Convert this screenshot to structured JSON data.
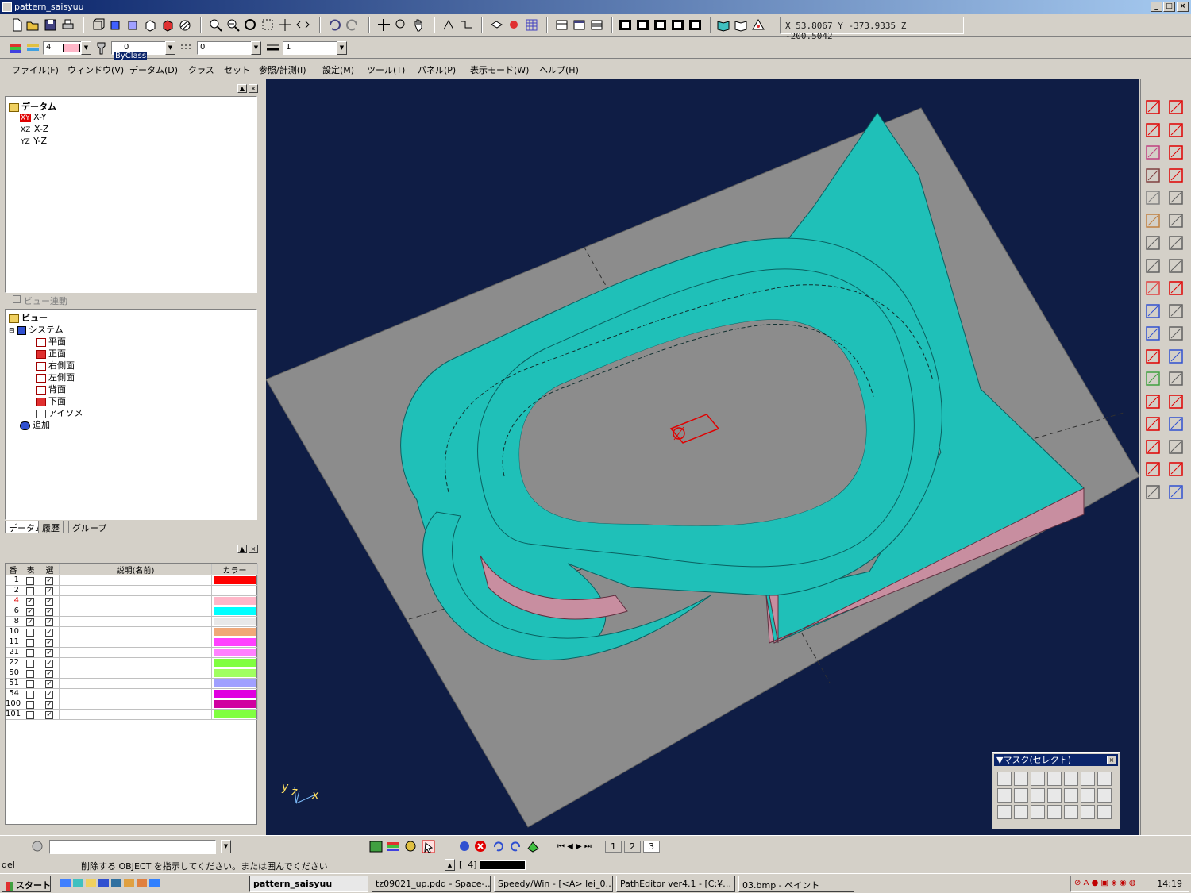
{
  "window": {
    "title": "pattern_saisyuu"
  },
  "coords": {
    "text": "X  53.8067  Y  -373.9335  Z  -200.5042"
  },
  "toolbar2": {
    "layer_value": "4",
    "class_value": "0",
    "class_label": "ByClass",
    "linetype_value": "0",
    "lineweight_value": "1"
  },
  "menu": [
    "ファイル(F)",
    "ウィンドウ(V)",
    "データム(D)",
    "クラス",
    "セット",
    "参照/計測(I)",
    "設定(M)",
    "ツール(T)",
    "パネル(P)",
    "表示モード(W)",
    "ヘルプ(H)"
  ],
  "datum_tree": {
    "root": "データム",
    "items": [
      {
        "prefix": "XY",
        "label": "X-Y"
      },
      {
        "prefix": "XZ",
        "label": "X-Z"
      },
      {
        "prefix": "YZ",
        "label": "Y-Z"
      }
    ],
    "view_link": "ビュー連動"
  },
  "view_tree": {
    "root": "ビュー",
    "system": "システム",
    "items": [
      "平面",
      "正面",
      "右側面",
      "左側面",
      "背面",
      "下面",
      "アイソメ"
    ],
    "add": "追加"
  },
  "panel_tabs": [
    "データム",
    "履歴",
    "グループ"
  ],
  "layer_table": {
    "headers": [
      "番",
      "表",
      "選",
      "説明(名前)",
      "カラー"
    ],
    "rows": [
      {
        "num": "1",
        "show": false,
        "sel": true,
        "color": "#ff0000",
        "highlight": false
      },
      {
        "num": "2",
        "show": false,
        "sel": true,
        "color": "#ffffff",
        "highlight": false
      },
      {
        "num": "4",
        "show": true,
        "sel": true,
        "color": "#ffb6c8",
        "highlight": true
      },
      {
        "num": "6",
        "show": true,
        "sel": true,
        "color": "#00ffff",
        "highlight": false
      },
      {
        "num": "8",
        "show": true,
        "sel": true,
        "color": "#e8e8e8",
        "highlight": false
      },
      {
        "num": "10",
        "show": false,
        "sel": true,
        "color": "#f0a878",
        "highlight": false
      },
      {
        "num": "11",
        "show": false,
        "sel": true,
        "color": "#ff40ff",
        "highlight": false
      },
      {
        "num": "21",
        "show": false,
        "sel": true,
        "color": "#ff80ff",
        "highlight": false
      },
      {
        "num": "22",
        "show": false,
        "sel": true,
        "color": "#80ff40",
        "highlight": false
      },
      {
        "num": "50",
        "show": false,
        "sel": true,
        "color": "#a0ff60",
        "highlight": false
      },
      {
        "num": "51",
        "show": false,
        "sel": true,
        "color": "#a0a0ff",
        "highlight": false
      },
      {
        "num": "54",
        "show": false,
        "sel": true,
        "color": "#e000e0",
        "highlight": false
      },
      {
        "num": "100",
        "show": false,
        "sel": true,
        "color": "#d000a0",
        "highlight": false
      },
      {
        "num": "101",
        "show": false,
        "sel": true,
        "color": "#80ff40",
        "highlight": false
      }
    ]
  },
  "axis": {
    "y": "y",
    "z": "z",
    "x": "x"
  },
  "mask_panel": {
    "title": "▼マスク(セレクト)"
  },
  "page_tabs": [
    "1",
    "2",
    "3"
  ],
  "status": {
    "command": "del",
    "prompt": "削除する OBJECT を指示してください。または囲んでください",
    "field": "4"
  },
  "taskbar": {
    "start": "スタート",
    "tasks": [
      "pattern_saisyuu",
      "tz09021_up.pdd - Space-…",
      "Speedy/Win - [<A> lei_0…",
      "PathEditor ver4.1 - [C:¥…",
      "03.bmp - ペイント"
    ],
    "clock": "14:19"
  },
  "colors": {
    "teal": "#1fc0b8",
    "pink": "#c88ea0",
    "floor": "#8c8c8c",
    "bg": "#0f1d45"
  }
}
